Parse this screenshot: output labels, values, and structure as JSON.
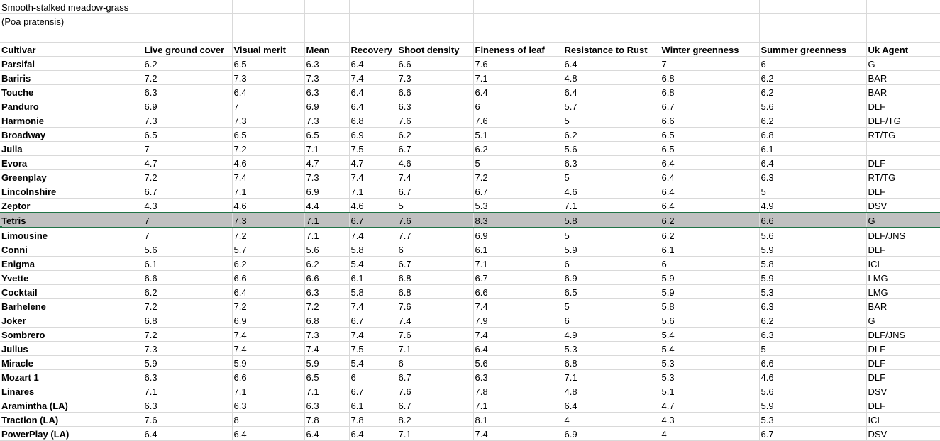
{
  "title_line1": "Smooth-stalked meadow-grass",
  "title_line2": "(Poa pratensis)",
  "headers": [
    "Cultivar",
    "Live ground cover",
    "Visual merit",
    "Mean",
    "Recovery",
    "Shoot density",
    "Fineness of leaf",
    "Resistance to Rust",
    "Winter greenness",
    "Summer greenness",
    "Uk Agent"
  ],
  "selected_row": "Tetris",
  "rows": [
    [
      "Parsifal",
      "6.2",
      "6.5",
      "6.3",
      "6.4",
      "6.6",
      "7.6",
      "6.4",
      "7",
      "6",
      "G"
    ],
    [
      "Bariris",
      "7.2",
      "7.3",
      "7.3",
      "7.4",
      "7.3",
      "7.1",
      "4.8",
      "6.8",
      "6.2",
      "BAR"
    ],
    [
      "Touche",
      "6.3",
      "6.4",
      "6.3",
      "6.4",
      "6.6",
      "6.4",
      "6.4",
      "6.8",
      "6.2",
      "BAR"
    ],
    [
      "Panduro",
      "6.9",
      "7",
      "6.9",
      "6.4",
      "6.3",
      "6",
      "5.7",
      "6.7",
      "5.6",
      "DLF"
    ],
    [
      "Harmonie",
      "7.3",
      "7.3",
      "7.3",
      "6.8",
      "7.6",
      "7.6",
      "5",
      "6.6",
      "6.2",
      "DLF/TG"
    ],
    [
      "Broadway",
      "6.5",
      "6.5",
      "6.5",
      "6.9",
      "6.2",
      "5.1",
      "6.2",
      "6.5",
      "6.8",
      "RT/TG"
    ],
    [
      "Julia",
      "7",
      "7.2",
      "7.1",
      "7.5",
      "6.7",
      "6.2",
      "5.6",
      "6.5",
      "6.1",
      ""
    ],
    [
      "Evora",
      "4.7",
      "4.6",
      "4.7",
      "4.7",
      "4.6",
      "5",
      "6.3",
      "6.4",
      "6.4",
      "DLF"
    ],
    [
      "Greenplay",
      "7.2",
      "7.4",
      "7.3",
      "7.4",
      "7.4",
      "7.2",
      "5",
      "6.4",
      "6.3",
      "RT/TG"
    ],
    [
      "Lincolnshire",
      "6.7",
      "7.1",
      "6.9",
      "7.1",
      "6.7",
      "6.7",
      "4.6",
      "6.4",
      "5",
      "DLF"
    ],
    [
      "Zeptor",
      "4.3",
      "4.6",
      "4.4",
      "4.6",
      "5",
      "5.3",
      "7.1",
      "6.4",
      "4.9",
      "DSV"
    ],
    [
      "Tetris",
      "7",
      "7.3",
      "7.1",
      "6.7",
      "7.6",
      "8.3",
      "5.8",
      "6.2",
      "6.6",
      "G"
    ],
    [
      "Limousine",
      "7",
      "7.2",
      "7.1",
      "7.4",
      "7.7",
      "6.9",
      "5",
      "6.2",
      "5.6",
      "DLF/JNS"
    ],
    [
      "Conni",
      "5.6",
      "5.7",
      "5.6",
      "5.8",
      "6",
      "6.1",
      "5.9",
      "6.1",
      "5.9",
      "DLF"
    ],
    [
      "Enigma",
      "6.1",
      "6.2",
      "6.2",
      "5.4",
      "6.7",
      "7.1",
      "6",
      "6",
      "5.8",
      "ICL"
    ],
    [
      "Yvette",
      "6.6",
      "6.6",
      "6.6",
      "6.1",
      "6.8",
      "6.7",
      "6.9",
      "5.9",
      "5.9",
      "LMG"
    ],
    [
      "Cocktail",
      "6.2",
      "6.4",
      "6.3",
      "5.8",
      "6.8",
      "6.6",
      "6.5",
      "5.9",
      "5.3",
      "LMG"
    ],
    [
      "Barhelene",
      "7.2",
      "7.2",
      "7.2",
      "7.4",
      "7.6",
      "7.4",
      "5",
      "5.8",
      "6.3",
      "BAR"
    ],
    [
      "Joker",
      "6.8",
      "6.9",
      "6.8",
      "6.7",
      "7.4",
      "7.9",
      "6",
      "5.6",
      "6.2",
      "G"
    ],
    [
      "Sombrero",
      "7.2",
      "7.4",
      "7.3",
      "7.4",
      "7.6",
      "7.4",
      "4.9",
      "5.4",
      "6.3",
      "DLF/JNS"
    ],
    [
      "Julius",
      "7.3",
      "7.4",
      "7.4",
      "7.5",
      "7.1",
      "6.4",
      "5.3",
      "5.4",
      "5",
      "DLF"
    ],
    [
      "Miracle",
      "5.9",
      "5.9",
      "5.9",
      "5.4",
      "6",
      "5.6",
      "6.8",
      "5.3",
      "6.6",
      "DLF"
    ],
    [
      "Mozart 1",
      "6.3",
      "6.6",
      "6.5",
      "6",
      "6.7",
      "6.3",
      "7.1",
      "5.3",
      "4.6",
      "DLF"
    ],
    [
      "Linares",
      "7.1",
      "7.1",
      "7.1",
      "6.7",
      "7.6",
      "7.8",
      "4.8",
      "5.1",
      "5.6",
      "DSV"
    ],
    [
      "Aramintha (LA)",
      "6.3",
      "6.3",
      "6.3",
      "6.1",
      "6.7",
      "7.1",
      "6.4",
      "4.7",
      "5.9",
      "DLF"
    ],
    [
      "Traction (LA)",
      "7.6",
      "8",
      "7.8",
      "7.8",
      "8.2",
      "8.1",
      "4",
      "4.3",
      "5.3",
      "ICL"
    ],
    [
      "PowerPlay (LA)",
      "6.4",
      "6.4",
      "6.4",
      "6.4",
      "7.1",
      "7.4",
      "6.9",
      "4",
      "6.7",
      "DSV"
    ]
  ]
}
